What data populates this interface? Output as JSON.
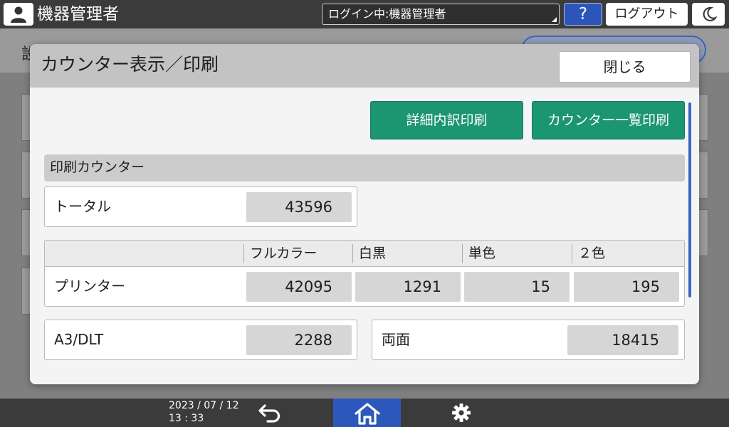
{
  "topbar": {
    "user_title": "機器管理者",
    "login_status": "ログイン中:機器管理者",
    "help_label": "?",
    "logout_label": "ログアウト"
  },
  "background": {
    "title_fragment": "設"
  },
  "dialog": {
    "title": "カウンター表示／印刷",
    "close_label": "閉じる",
    "detail_print_label": "詳細内訳印刷",
    "counter_list_print_label": "カウンター一覧印刷",
    "section_title": "印刷カウンター",
    "total": {
      "label": "トータル",
      "value": "43596"
    },
    "printer_table": {
      "columns": [
        "フルカラー",
        "白黒",
        "単色",
        "２色"
      ],
      "row_label": "プリンター",
      "values": [
        "42095",
        "1291",
        "15",
        "195"
      ]
    },
    "a3dlt": {
      "label": "A3/DLT",
      "value": "2288"
    },
    "duplex": {
      "label": "両面",
      "value": "18415"
    }
  },
  "bottombar": {
    "date": "2023 / 07 / 12",
    "time": "13 : 33"
  },
  "colors": {
    "accent_green": "#1c9571",
    "accent_blue": "#2d58bb",
    "bar_dark": "#3b3b3b"
  }
}
